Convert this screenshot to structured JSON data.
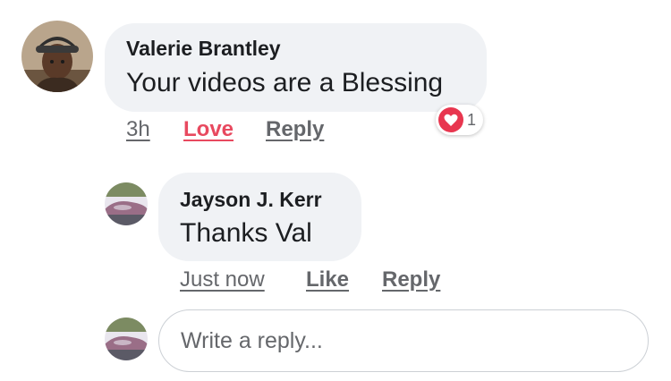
{
  "comment": {
    "author": "Valerie Brantley",
    "text": "Your videos are a Blessing",
    "time": "3h",
    "reaction_action": "Love",
    "reply_action": "Reply",
    "reaction_icon": "heart-icon",
    "reaction_count": "1"
  },
  "reply": {
    "author": "Jayson J. Kerr",
    "text": "Thanks Val",
    "time": "Just now",
    "like_action": "Like",
    "reply_action": "Reply"
  },
  "composer": {
    "placeholder": "Write a reply..."
  },
  "colors": {
    "bubble": "#f0f2f5",
    "love": "#e8495f",
    "meta_text": "#65676b"
  }
}
